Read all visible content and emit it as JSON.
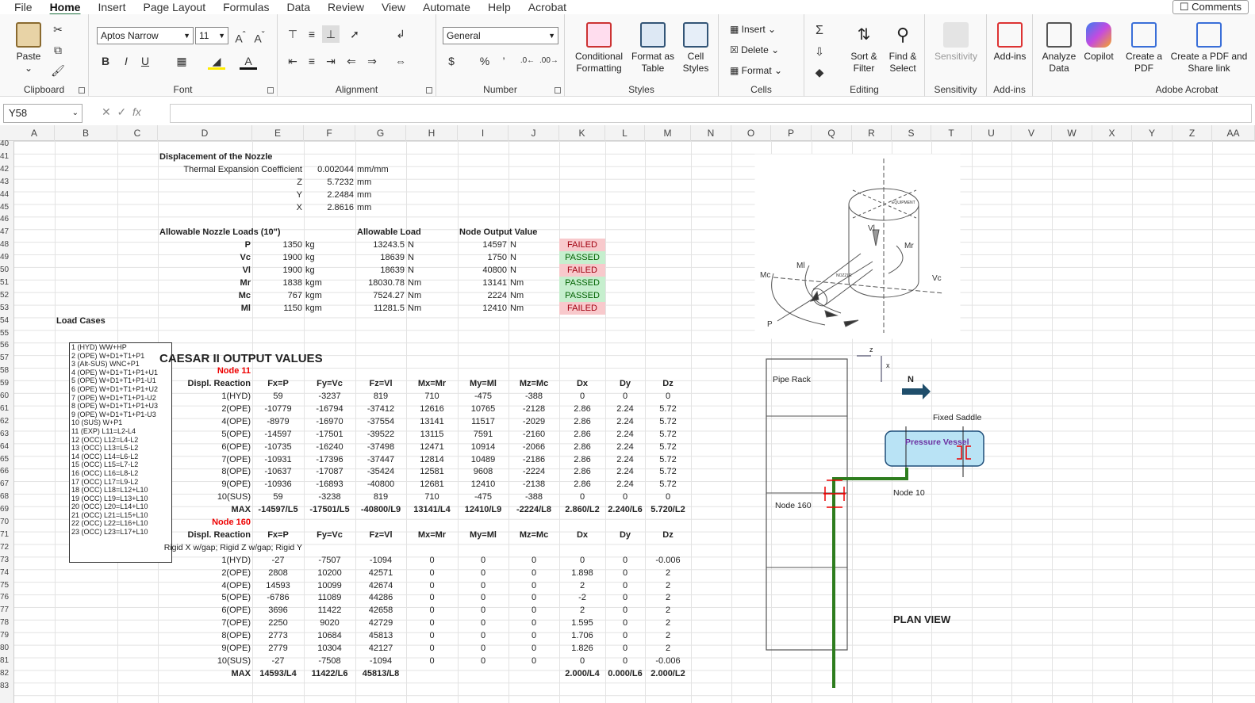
{
  "tabs": [
    "File",
    "Home",
    "Insert",
    "Page Layout",
    "Formulas",
    "Data",
    "Review",
    "View",
    "Automate",
    "Help",
    "Acrobat"
  ],
  "comments_label": "Comments",
  "ribbon": {
    "clipboard": {
      "label": "Clipboard",
      "paste": "Paste"
    },
    "font": {
      "label": "Font",
      "name": "Aptos Narrow",
      "size": "11"
    },
    "alignment": {
      "label": "Alignment"
    },
    "number": {
      "label": "Number",
      "format": "General"
    },
    "styles": {
      "label": "Styles",
      "cond": "Conditional Formatting",
      "table": "Format as Table",
      "cell": "Cell Styles"
    },
    "cells": {
      "label": "Cells",
      "insert": "Insert",
      "delete": "Delete",
      "format": "Format"
    },
    "editing": {
      "label": "Editing",
      "sort": "Sort & Filter",
      "find": "Find & Select"
    },
    "sensitivity": {
      "label": "Sensitivity",
      "btn": "Sensitivity"
    },
    "addins": {
      "label": "Add-ins",
      "btn": "Add-ins"
    },
    "analyze": "Analyze Data",
    "copilot": "Copilot",
    "acrobat": {
      "label": "Adobe Acrobat",
      "create": "Create a PDF",
      "share": "Create a PDF and Share link"
    }
  },
  "namebox": "Y58",
  "columns": [
    "A",
    "B",
    "C",
    "D",
    "E",
    "F",
    "G",
    "H",
    "I",
    "J",
    "K",
    "L",
    "M",
    "N",
    "O",
    "P",
    "Q",
    "R",
    "S",
    "T",
    "U",
    "V",
    "W",
    "X",
    "Y",
    "Z",
    "AA"
  ],
  "rows": [
    "40",
    "41",
    "42",
    "43",
    "44",
    "45",
    "46",
    "47",
    "48",
    "49",
    "50",
    "51",
    "52",
    "53",
    "54",
    "55",
    "56",
    "57",
    "58",
    "59",
    "60",
    "61",
    "62",
    "63",
    "64",
    "65",
    "66",
    "67",
    "68",
    "69",
    "70",
    "71",
    "72",
    "73",
    "74",
    "75",
    "76",
    "77",
    "78",
    "79",
    "80",
    "81",
    "82",
    "83"
  ],
  "displacement": {
    "title": "Displacement of the Nozzle",
    "tec_label": "Thermal Expansion Coefficient",
    "tec": "0.002044",
    "unit": "mm/mm",
    "rows": [
      [
        "Z",
        "5.7232",
        "mm"
      ],
      [
        "Y",
        "2.2484",
        "mm"
      ],
      [
        "X",
        "2.8616",
        "mm"
      ]
    ]
  },
  "allowable": {
    "title": "Allowable Nozzle Loads (10\")",
    "h2": "Allowable Load",
    "h3": "Node Output Value",
    "rows": [
      [
        "P",
        "1350",
        "kg",
        "13243.5",
        "N",
        "14597",
        "N",
        "FAILED"
      ],
      [
        "Vc",
        "1900",
        "kg",
        "18639",
        "N",
        "1750",
        "N",
        "PASSED"
      ],
      [
        "Vl",
        "1900",
        "kg",
        "18639",
        "N",
        "40800",
        "N",
        "FAILED"
      ],
      [
        "Mr",
        "1838",
        "kgm",
        "18030.78",
        "Nm",
        "13141",
        "Nm",
        "PASSED"
      ],
      [
        "Mc",
        "767",
        "kgm",
        "7524.27",
        "Nm",
        "2224",
        "Nm",
        "PASSED"
      ],
      [
        "Ml",
        "1150",
        "kgm",
        "11281.5",
        "Nm",
        "12410",
        "Nm",
        "FAILED"
      ]
    ]
  },
  "load_cases": {
    "title": "Load Cases",
    "items": [
      "1 (HYD) WW+HP",
      "2 (OPE) W+D1+T1+P1",
      "3 (Alt-SUS) WNC+P1",
      "4 (OPE) W+D1+T1+P1+U1",
      "5 (OPE) W+D1+T1+P1-U1",
      "6 (OPE) W+D1+T1+P1+U2",
      "7 (OPE) W+D1+T1+P1-U2",
      "8 (OPE) W+D1+T1+P1+U3",
      "9 (OPE) W+D1+T1+P1-U3",
      "10 (SUS) W+P1",
      "11 (EXP) L11=L2-L4",
      "12 (OCC) L12=L4-L2",
      "13 (OCC) L13=L5-L2",
      "14 (OCC) L14=L6-L2",
      "15 (OCC) L15=L7-L2",
      "16 (OCC) L16=L8-L2",
      "17 (OCC) L17=L9-L2",
      "18 (OCC) L18=L12+L10",
      "19 (OCC) L19=L13+L10",
      "20 (OCC) L20=L14+L10",
      "21 (OCC) L21=L15+L10",
      "22 (OCC) L22=L16+L10",
      "23 (OCC) L23=L17+L10"
    ]
  },
  "caesar": {
    "title": "CAESAR II OUTPUT VALUES",
    "headers": [
      "Displ. Reaction",
      "Fx=P",
      "Fy=Vc",
      "Fz=Vl",
      "Mx=Mr",
      "My=Ml",
      "Mz=Mc",
      "Dx",
      "Dy",
      "Dz"
    ],
    "node11": {
      "label": "Node 11",
      "rows": [
        [
          "1(HYD)",
          "59",
          "-3237",
          "819",
          "710",
          "-475",
          "-388",
          "0",
          "0",
          "0"
        ],
        [
          "2(OPE)",
          "-10779",
          "-16794",
          "-37412",
          "12616",
          "10765",
          "-2128",
          "2.86",
          "2.24",
          "5.72"
        ],
        [
          "4(OPE)",
          "-8979",
          "-16970",
          "-37554",
          "13141",
          "11517",
          "-2029",
          "2.86",
          "2.24",
          "5.72"
        ],
        [
          "5(OPE)",
          "-14597",
          "-17501",
          "-39522",
          "13115",
          "7591",
          "-2160",
          "2.86",
          "2.24",
          "5.72"
        ],
        [
          "6(OPE)",
          "-10735",
          "-16240",
          "-37498",
          "12471",
          "10914",
          "-2066",
          "2.86",
          "2.24",
          "5.72"
        ],
        [
          "7(OPE)",
          "-10931",
          "-17396",
          "-37447",
          "12814",
          "10489",
          "-2186",
          "2.86",
          "2.24",
          "5.72"
        ],
        [
          "8(OPE)",
          "-10637",
          "-17087",
          "-35424",
          "12581",
          "9608",
          "-2224",
          "2.86",
          "2.24",
          "5.72"
        ],
        [
          "9(OPE)",
          "-10936",
          "-16893",
          "-40800",
          "12681",
          "12410",
          "-2138",
          "2.86",
          "2.24",
          "5.72"
        ],
        [
          "10(SUS)",
          "59",
          "-3238",
          "819",
          "710",
          "-475",
          "-388",
          "0",
          "0",
          "0"
        ],
        [
          "MAX",
          "-14597/L5",
          "-17501/L5",
          "-40800/L9",
          "13141/L4",
          "12410/L9",
          "-2224/L8",
          "2.860/L2",
          "2.240/L6",
          "5.720/L2"
        ]
      ]
    },
    "node160": {
      "label": "Node 160",
      "note": "Rigid X w/gap; Rigid Z w/gap; Rigid Y",
      "rows": [
        [
          "1(HYD)",
          "-27",
          "-7507",
          "-1094",
          "0",
          "0",
          "0",
          "0",
          "0",
          "-0.006"
        ],
        [
          "2(OPE)",
          "2808",
          "10200",
          "42571",
          "0",
          "0",
          "0",
          "1.898",
          "0",
          "2"
        ],
        [
          "4(OPE)",
          "14593",
          "10099",
          "42674",
          "0",
          "0",
          "0",
          "2",
          "0",
          "2"
        ],
        [
          "5(OPE)",
          "-6786",
          "11089",
          "44286",
          "0",
          "0",
          "0",
          "-2",
          "0",
          "2"
        ],
        [
          "6(OPE)",
          "3696",
          "11422",
          "42658",
          "0",
          "0",
          "0",
          "2",
          "0",
          "2"
        ],
        [
          "7(OPE)",
          "2250",
          "9020",
          "42729",
          "0",
          "0",
          "0",
          "1.595",
          "0",
          "2"
        ],
        [
          "8(OPE)",
          "2773",
          "10684",
          "45813",
          "0",
          "0",
          "0",
          "1.706",
          "0",
          "2"
        ],
        [
          "9(OPE)",
          "2779",
          "10304",
          "42127",
          "0",
          "0",
          "0",
          "1.826",
          "0",
          "2"
        ],
        [
          "10(SUS)",
          "-27",
          "-7508",
          "-1094",
          "0",
          "0",
          "0",
          "0",
          "0",
          "-0.006"
        ],
        [
          "MAX",
          "14593/L4",
          "11422/L6",
          "45813/L8",
          "",
          "",
          "",
          "2.000/L4",
          "0.000/L6",
          "2.000/L2"
        ]
      ]
    }
  },
  "diagram": {
    "equipment": "EQUIPMENT",
    "nozzle": "NOZZLE",
    "vl": "Vl",
    "mr": "Mr",
    "ml": "Ml",
    "mc": "Mc",
    "vc": "Vc",
    "p": "P"
  },
  "plan": {
    "pipe_rack": "Pipe Rack",
    "node160": "Node 160",
    "node10": "Node 10",
    "fixed_saddle": "Fixed Saddle",
    "vessel": "Pressure Vessel",
    "north": "N",
    "z": "z",
    "x": "x",
    "title": "PLAN VIEW"
  },
  "colors": {
    "failed_bg": "#f8c9cc",
    "passed_bg": "#c6efce",
    "pipe": "#2e7d1e",
    "vessel": "#b9e3f5",
    "accent": "#1a6d3a"
  }
}
